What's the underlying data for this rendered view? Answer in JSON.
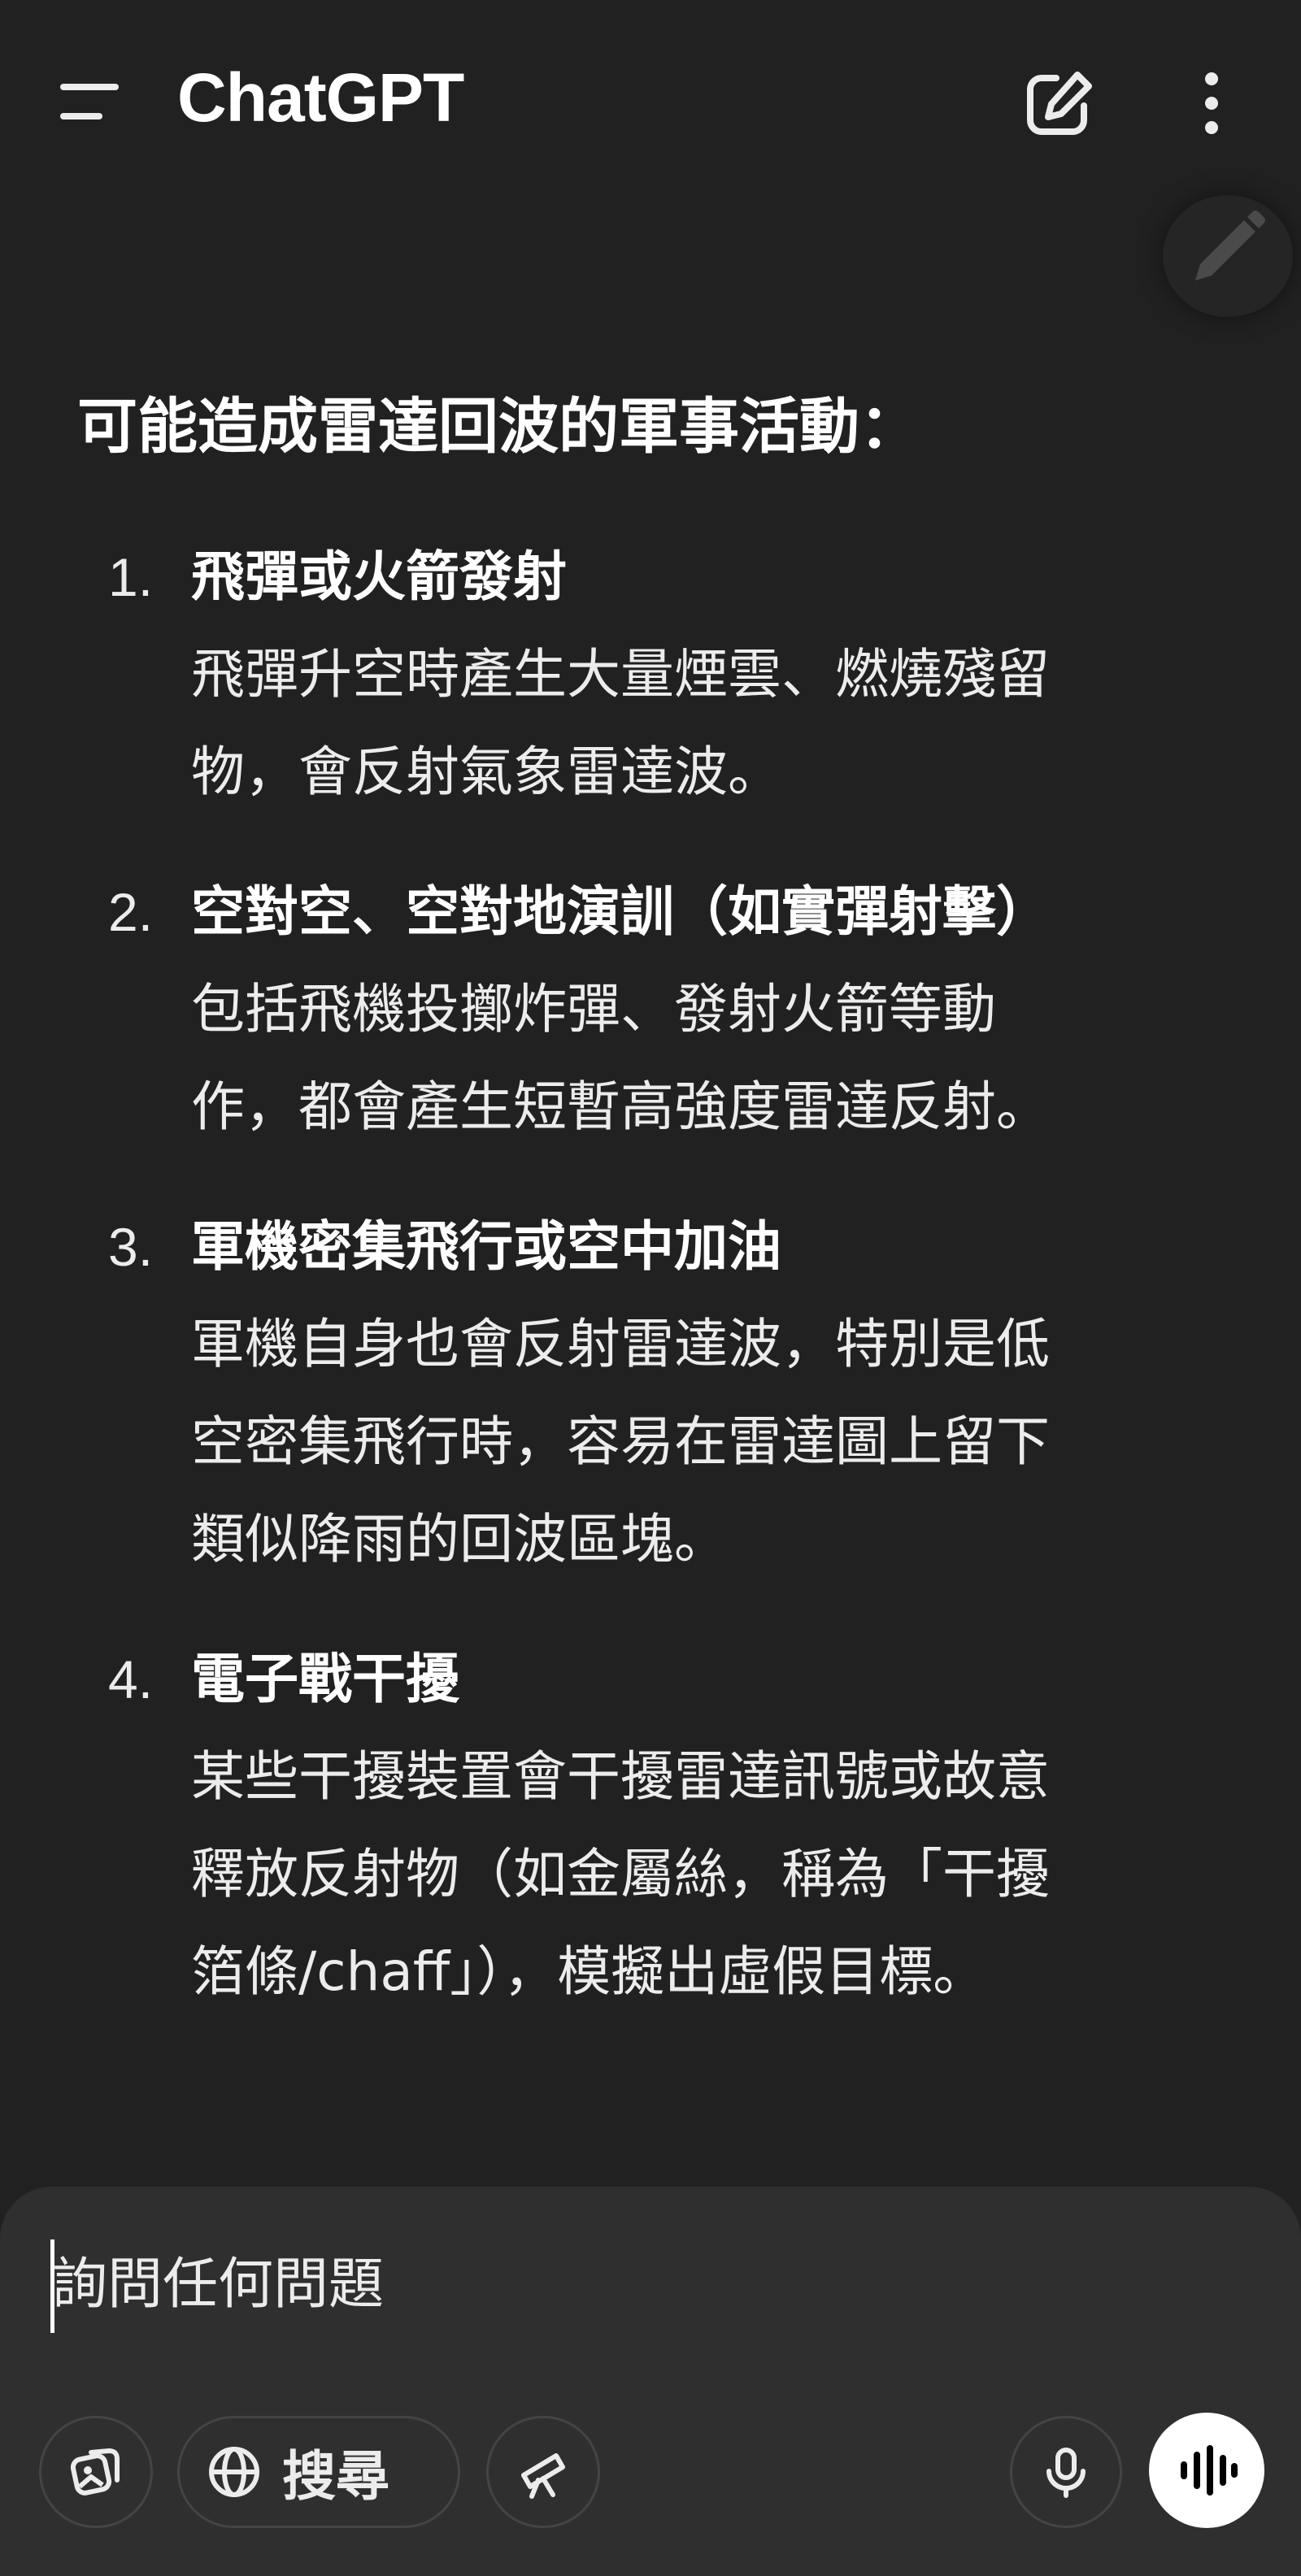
{
  "header": {
    "app_title": "ChatGPT"
  },
  "message": {
    "heading": "可能造成雷達回波的軍事活動：",
    "items": [
      {
        "num": "1.",
        "title": "飛彈或火箭發射",
        "desc_lines": [
          "飛彈升空時產生大量煙雲、燃燒殘留",
          "物，會反射氣象雷達波。"
        ]
      },
      {
        "num": "2.",
        "title": "空對空、空對地演訓（如實彈射擊）",
        "desc_lines": [
          "包括飛機投擲炸彈、發射火箭等動",
          "作，都會產生短暫高強度雷達反射。"
        ]
      },
      {
        "num": "3.",
        "title": "軍機密集飛行或空中加油",
        "desc_lines": [
          "軍機自身也會反射雷達波，特別是低",
          "空密集飛行時，容易在雷達圖上留下",
          "類似降雨的回波區塊。"
        ]
      },
      {
        "num": "4.",
        "title": "電子戰干擾",
        "desc_lines": [
          "某些干擾裝置會干擾雷達訊號或故意",
          "釋放反射物（如金屬絲，稱為「干擾",
          "箔條/chaff」），模擬出虛假目標。"
        ]
      }
    ]
  },
  "composer": {
    "placeholder": "詢問任何問題",
    "search_label": "搜尋"
  },
  "icons": {
    "menu": "menu-icon",
    "compose": "new-chat-icon",
    "more": "more-vertical-icon",
    "edit": "pencil-icon",
    "attach": "image-attach-icon",
    "globe": "globe-icon",
    "tools": "telescope-icon",
    "mic": "mic-icon",
    "voice": "voice-waveform-icon"
  },
  "colors": {
    "background": "#212121",
    "composer": "#2f2f2f",
    "text": "#ececec"
  }
}
